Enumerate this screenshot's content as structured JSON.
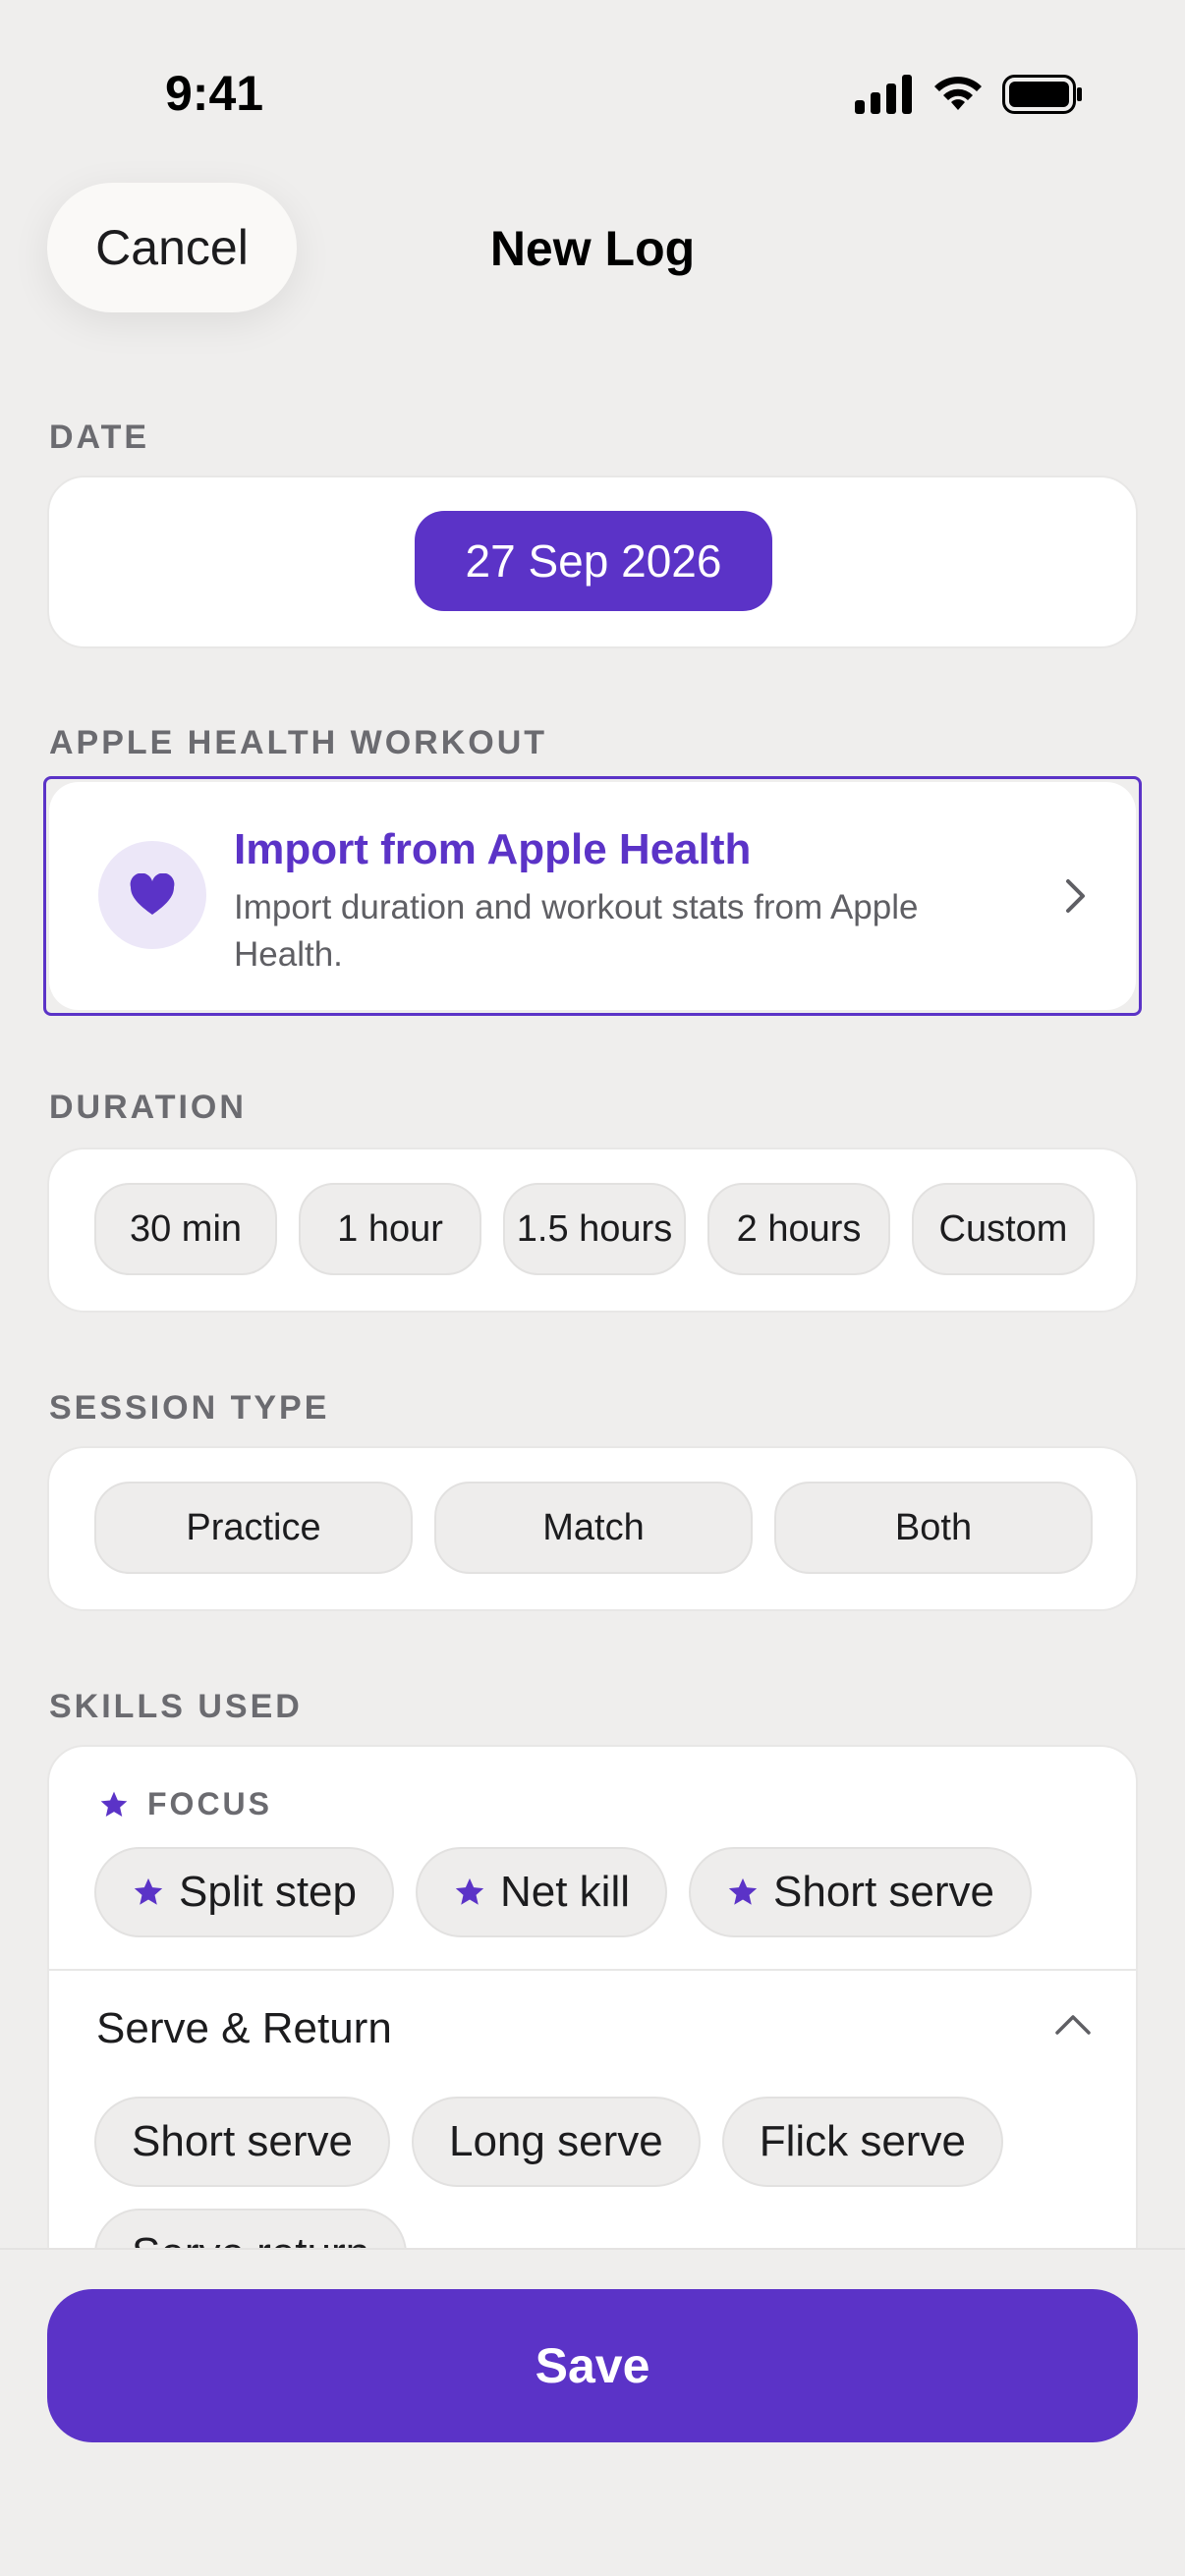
{
  "status": {
    "time": "9:41"
  },
  "nav": {
    "cancel": "Cancel",
    "title": "New Log"
  },
  "date": {
    "label": "DATE",
    "value": "27 Sep 2026"
  },
  "health": {
    "label": "APPLE HEALTH WORKOUT",
    "title": "Import from Apple Health",
    "subtitle": "Import duration and workout stats from Apple Health."
  },
  "duration": {
    "label": "DURATION",
    "options": [
      "30 min",
      "1 hour",
      "1.5 hours",
      "2 hours",
      "Custom"
    ]
  },
  "session": {
    "label": "SESSION TYPE",
    "options": [
      "Practice",
      "Match",
      "Both"
    ]
  },
  "skills": {
    "label": "SKILLS USED",
    "focus_label": "FOCUS",
    "focus": [
      "Split step",
      "Net kill",
      "Short serve"
    ],
    "group_title": "Serve & Return",
    "group_skills": [
      "Short serve",
      "Long serve",
      "Flick serve",
      "Serve return"
    ]
  },
  "save": "Save",
  "colors": {
    "accent": "#5B33C7",
    "background": "#EFEEED",
    "card": "#FFFFFF"
  },
  "icons": [
    "signal-icon",
    "wifi-icon",
    "battery-icon",
    "heart-icon",
    "chevron-right-icon",
    "star-icon",
    "chevron-up-icon"
  ]
}
